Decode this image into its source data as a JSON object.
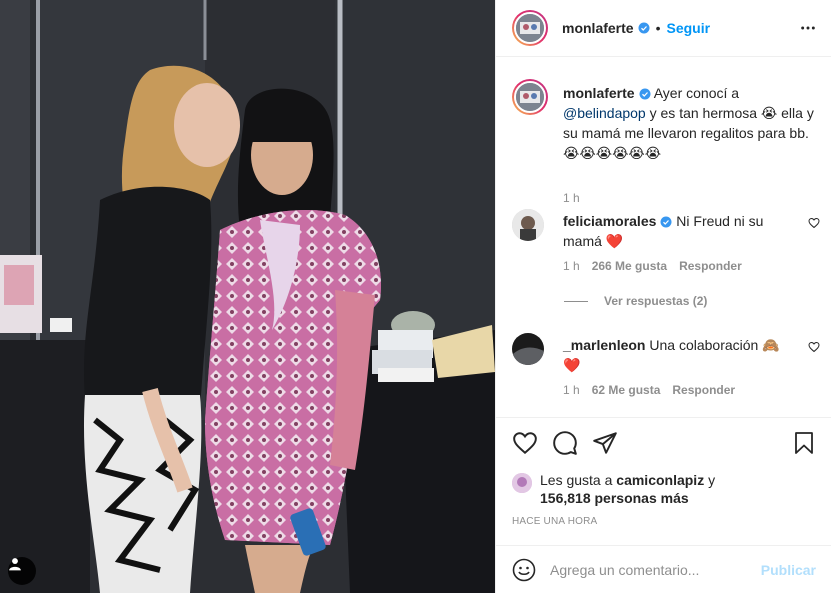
{
  "post": {
    "photo_alt": "Two women posing together backstage",
    "tag_icon": "user-icon"
  },
  "header": {
    "username": "monlaferte",
    "dot": "•",
    "follow_label": "Seguir",
    "more_icon": "more-options-icon"
  },
  "caption": {
    "username": "monlaferte",
    "text_before": " Ayer conocí a ",
    "mention": "@belindapop",
    "text_after": " y es tan hermosa 😭 ella y su mamá me llevaron regalitos para bb. 😭😭😭😭😭😭",
    "time": "1 h"
  },
  "comments": [
    {
      "username": "feliciamorales",
      "text": " Ni Freud ni su mamá ❤️",
      "time": "1 h",
      "likes": "266 Me gusta",
      "reply_label": "Responder",
      "view_replies": "Ver respuestas (2)"
    },
    {
      "username": "_marlenleon",
      "text": " Una colaboración 🙈 ❤️",
      "time": "1 h",
      "likes": "62 Me gusta",
      "reply_label": "Responder"
    }
  ],
  "likes": {
    "prefix": "Les gusta a ",
    "user": "camiconlapiz",
    "mid": " y",
    "count": "156,818 personas más"
  },
  "posted_ago": "Hace una hora",
  "add_comment": {
    "placeholder": "Agrega un comentario...",
    "publish_label": "Publicar"
  },
  "colors": {
    "link": "#0095f6",
    "mention": "#00376b",
    "muted": "#8e8e8e",
    "border": "#efefef"
  }
}
